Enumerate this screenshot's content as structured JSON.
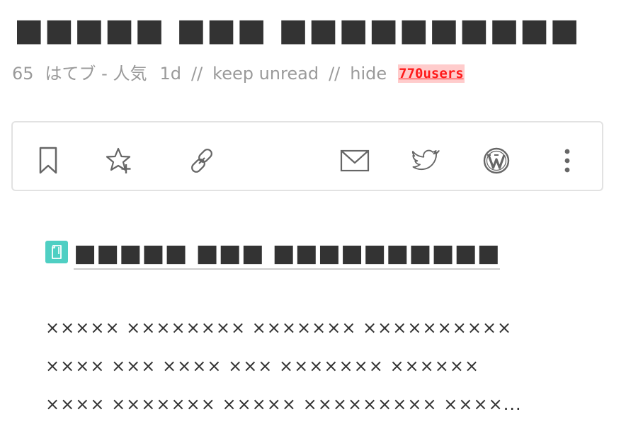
{
  "entry": {
    "title": "■■■■■ ■■■ ■■■■■■■■■■",
    "count": "65",
    "source": "はてブ - 人気",
    "age": "1d",
    "sep": "//",
    "keep_unread": "keep unread",
    "hide": "hide",
    "users": "770users"
  },
  "toolbar": {
    "buttons": [
      {
        "icon": "bookmark-icon"
      },
      {
        "icon": "star-plus-icon"
      },
      {
        "icon": "link-icon"
      },
      {
        "icon": "mail-icon"
      },
      {
        "icon": "twitter-icon"
      },
      {
        "icon": "wordpress-icon"
      },
      {
        "icon": "more-vertical-icon"
      }
    ]
  },
  "article": {
    "source_icon": "document-icon",
    "source_color": "#4fcfc3",
    "title": "■■■■■ ■■■ ■■■■■■■■■■",
    "description": [
      "××××× ×××××××× ××××××× ××××××××××",
      "×××× ××× ×××× ××× ××××××× ××××××",
      "×××× ××××××× ××××× ××××××××× ××××..."
    ]
  },
  "colors": {
    "users_text": "#ff1a1a",
    "users_bg": "#ffcccc",
    "meta_text": "#9a9a9a",
    "title_text": "#333333"
  }
}
